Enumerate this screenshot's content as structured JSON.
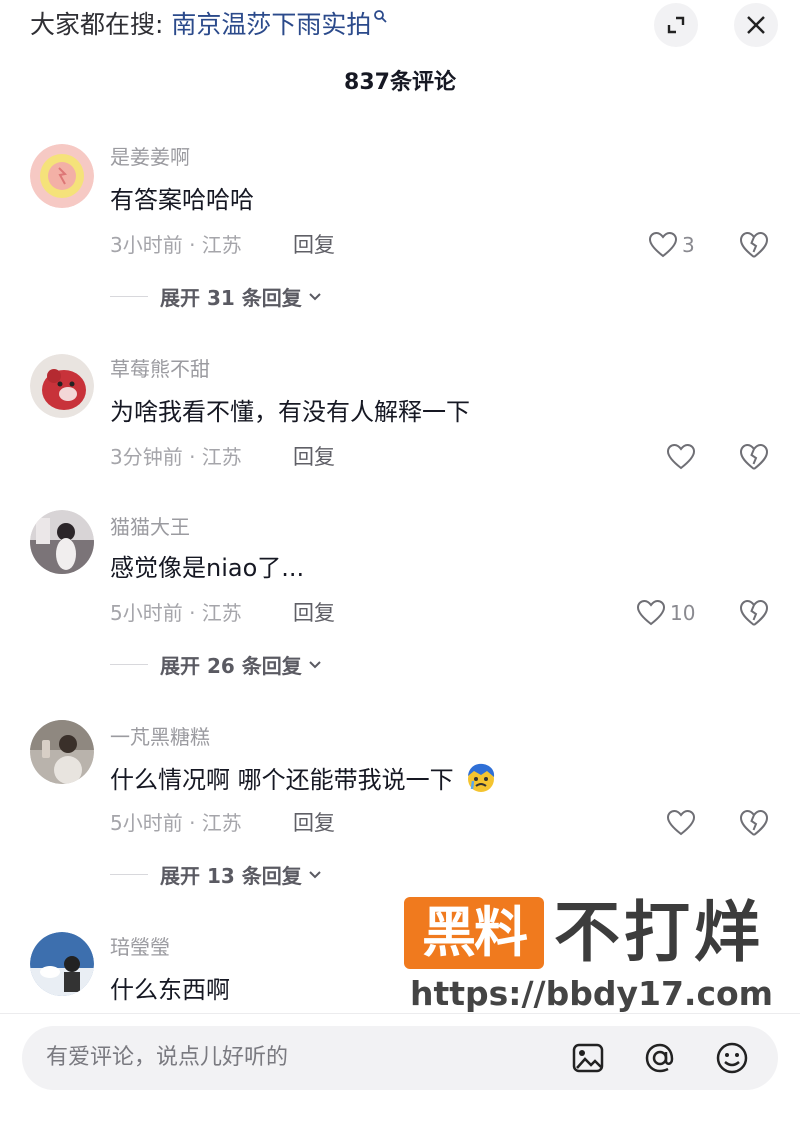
{
  "header": {
    "search_prefix": "大家都在搜: ",
    "search_keyword": "南京温莎下雨实拍",
    "expand_icon": "fullscreen-icon",
    "close_icon": "close-icon"
  },
  "comment_count_title": "837条评论",
  "comments": [
    {
      "username": "是姜姜啊",
      "text": "有答案哈哈哈",
      "meta": "3小时前 · 江苏",
      "reply_label": "回复",
      "likes": "3",
      "expand_label": "展开 31 条回复"
    },
    {
      "username": "草莓熊不甜",
      "text": "为啥我看不懂，有没有人解释一下",
      "meta": "3分钟前 · 江苏",
      "reply_label": "回复",
      "likes": ""
    },
    {
      "username": "猫猫大王",
      "text": "感觉像是niao了...",
      "meta": "5小时前 · 江苏",
      "reply_label": "回复",
      "likes": "10",
      "expand_label": "展开 26 条回复"
    },
    {
      "username": "一芃黑糖糕",
      "text": "什么情况啊 哪个还能带我说一下",
      "meta": "5小时前 · 江苏",
      "reply_label": "回复",
      "likes": "",
      "expand_label": "展开 13 条回复"
    },
    {
      "username": "琣瑩瑩",
      "text": "什么东西啊"
    }
  ],
  "watermark": {
    "badge": "黑料",
    "title": "不打烊",
    "url": "https://bbdy17.com"
  },
  "input": {
    "placeholder": "有爱评论，说点儿好听的"
  },
  "colors": {
    "search_keyword": "#2b4a8b",
    "watermark_orange": "#f07a1e",
    "muted_text": "#9b9ba0"
  }
}
